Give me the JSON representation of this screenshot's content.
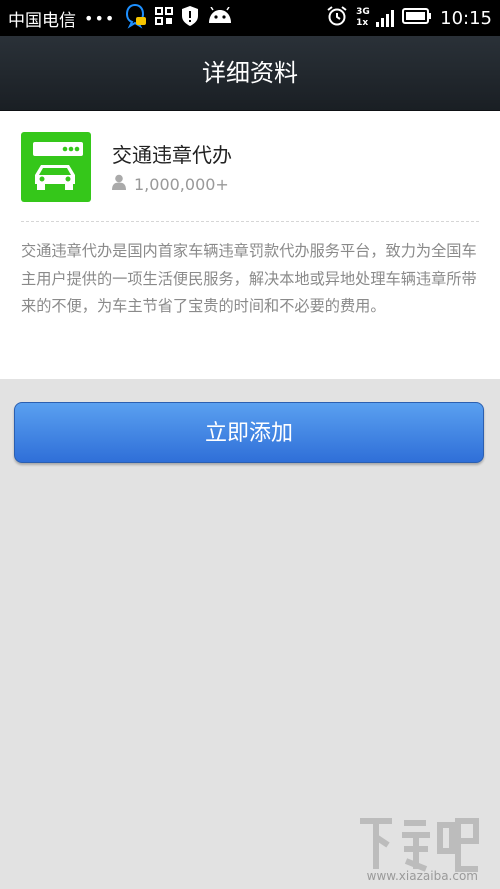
{
  "status_bar": {
    "carrier": "中国电信",
    "dots": "•••",
    "network": "3G",
    "network_sub": "1x",
    "time": "10:15"
  },
  "header": {
    "title": "详细资料"
  },
  "app": {
    "name": "交通违章代办",
    "downloads": "1,000,000+",
    "description": "交通违章代办是国内首家车辆违章罚款代办服务平台，致力为全国车主用户提供的一项生活便民服务，解决本地或异地处理车辆违章所带来的不便，为车主节省了宝贵的时间和不必要的费用。",
    "icon_color": "#35c71a"
  },
  "actions": {
    "add_label": "立即添加"
  },
  "watermark": {
    "url": "www.xiazaiba.com"
  }
}
